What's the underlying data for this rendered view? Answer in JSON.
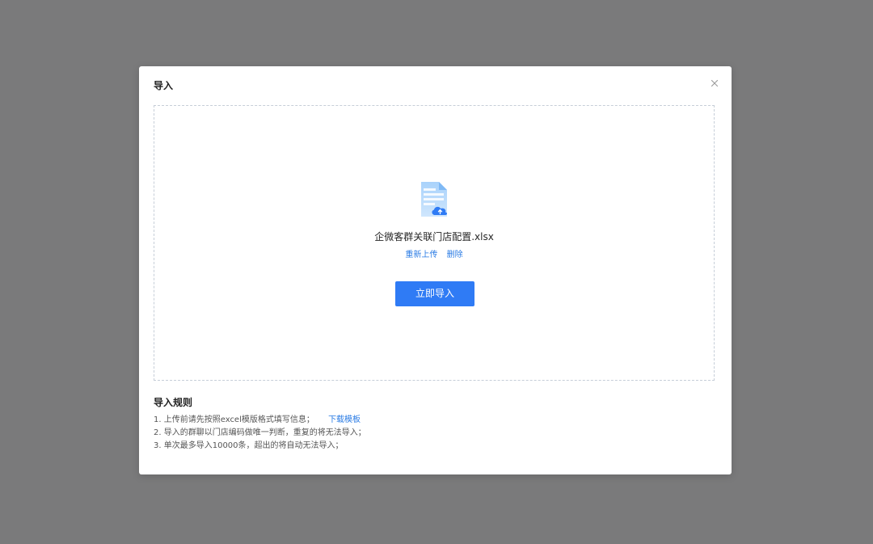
{
  "dialog": {
    "title": "导入",
    "close_icon": "close-icon"
  },
  "upload": {
    "file_icon": "excel-file-upload-icon",
    "file_name": "企微客群关联门店配置.xlsx",
    "reupload_label": "重新上传",
    "delete_label": "删除",
    "import_button_label": "立即导入"
  },
  "rules": {
    "title": "导入规则",
    "items": [
      "1. 上传前请先按照excel模版格式填写信息；",
      "2. 导入的群聊以门店编码做唯一判断，重复的将无法导入；",
      "3. 单次最多导入10000条，超出的将自动无法导入；"
    ],
    "download_link_label": "下载模板"
  },
  "colors": {
    "overlay": "#7a7a7b",
    "primary": "#2f7bf5",
    "link": "#2a7be4"
  }
}
